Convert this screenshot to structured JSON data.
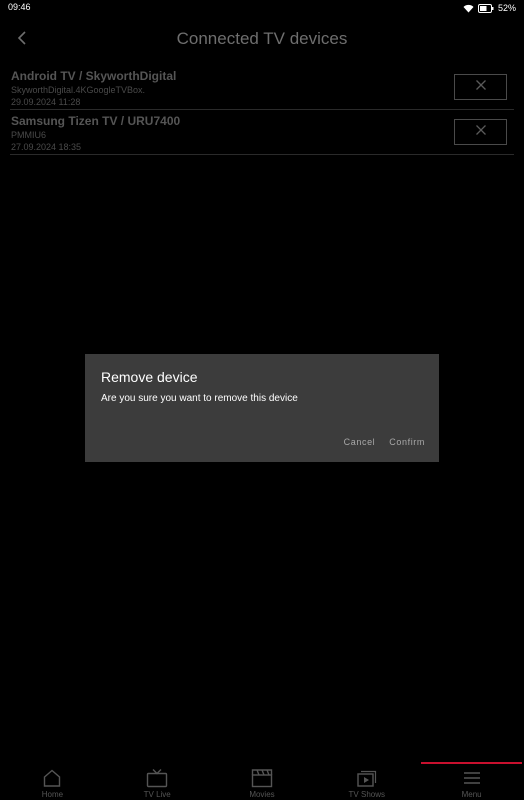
{
  "status": {
    "time": "09:46",
    "battery": "52%"
  },
  "header": {
    "title": "Connected TV devices"
  },
  "devices": [
    {
      "name": "Android TV / SkyworthDigital",
      "model": "SkyworthDigital.4KGoogleTVBox.",
      "date": "29.09.2024 11:28"
    },
    {
      "name": "Samsung Tizen TV / URU7400",
      "model": "PMMIU6",
      "date": "27.09.2024 18:35"
    }
  ],
  "dialog": {
    "title": "Remove device",
    "message": "Are you sure you want to remove this device",
    "cancel_label": "Cancel",
    "confirm_label": "Confirm"
  },
  "nav": {
    "items": [
      {
        "label": "Home",
        "icon": "home-icon"
      },
      {
        "label": "TV Live",
        "icon": "tv-icon"
      },
      {
        "label": "Movies",
        "icon": "clapperboard-icon"
      },
      {
        "label": "TV Shows",
        "icon": "tv-shows-icon"
      },
      {
        "label": "Menu",
        "icon": "menu-icon"
      }
    ],
    "active": "Menu",
    "accent_color": "#c8102e"
  }
}
